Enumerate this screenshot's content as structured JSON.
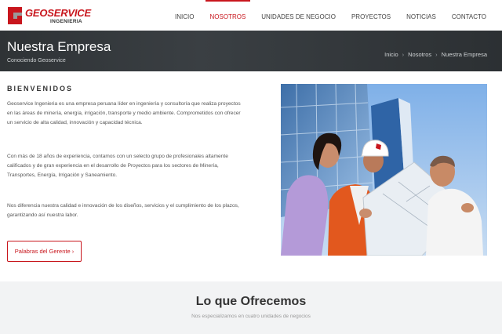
{
  "brand": {
    "name": "GEOSERVICE",
    "sub": "INGENIERIA",
    "color": "#c8161d"
  },
  "nav": {
    "items": [
      {
        "label": "INICIO",
        "active": false
      },
      {
        "label": "NOSOTROS",
        "active": true
      },
      {
        "label": "UNIDADES DE NEGOCIO",
        "active": false
      },
      {
        "label": "PROYECTOS",
        "active": false
      },
      {
        "label": "NOTICIAS",
        "active": false
      },
      {
        "label": "CONTACTO",
        "active": false
      }
    ]
  },
  "banner": {
    "title": "Nuestra Empresa",
    "subtitle": "Conociendo Geoservice",
    "breadcrumb": [
      "Inicio",
      "Nosotros",
      "Nuestra Empresa"
    ]
  },
  "main": {
    "heading": "BIENVENIDOS",
    "paragraphs": [
      "Geoservice Ingenieria es una empresa peruana líder en ingeniería y consultoría que realiza proyectos en las áreas de minería, energía, irrigación, transporte y medio ambiente. Comprometidos con ofrecer un servicio de alta calidad, innovación y capacidad técnica.",
      "Con más de 18 años de experiencia, contamos con un selecto grupo de profesionales altamente calificados y de gran experiencia en el desarrollo de Proyectos para los sectores de Minería, Transportes, Energía, Irrigación y Saneamiento.",
      "Nos diferencia nuestra calidad e innovación de los diseños, servicios y el cumplimiento de los plazos, garantizando así nuestra labor."
    ],
    "cta_label": "Palabras del Gerente ›"
  },
  "offer": {
    "title": "Lo que Ofrecemos",
    "subtitle": "Nos especializamos en cuatro unidades de negocios"
  }
}
